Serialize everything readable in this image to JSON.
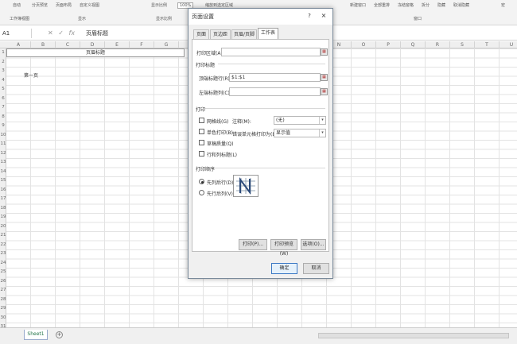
{
  "ribbon": {
    "texts": [
      "自动",
      "分页预览",
      "页面布局",
      "自定义视图",
      "显示比例",
      "100%",
      "缩放到选定区域",
      "新建窗口",
      "全部重排",
      "冻结窗格",
      "拆分",
      "隐藏",
      "取消隐藏",
      "宏",
      "工作簿视图",
      "显示",
      "显示比例",
      "窗口"
    ],
    "zoom_value": "100%"
  },
  "formula_bar": {
    "name_box": "A1",
    "formula": "页眉标题"
  },
  "grid": {
    "columns": [
      "A",
      "B",
      "C",
      "D",
      "E",
      "F",
      "G",
      "H",
      "I",
      "J",
      "K",
      "L",
      "M",
      "N",
      "O",
      "P",
      "Q",
      "R",
      "S",
      "T",
      "U",
      "V",
      "W"
    ],
    "rows": [
      "1",
      "2",
      "3",
      "4",
      "5",
      "6",
      "7",
      "8",
      "9",
      "10",
      "11",
      "12",
      "13",
      "14",
      "15",
      "16",
      "17",
      "18",
      "19",
      "20",
      "21",
      "22",
      "23",
      "24",
      "25",
      "26",
      "27",
      "28",
      "29",
      "30",
      "31"
    ],
    "title_cell": "页眉标题",
    "page_cell": "第一页"
  },
  "bottom": {
    "sheet_tab": "Sheet1",
    "add_sheet": "+"
  },
  "dialog": {
    "title": "页面设置",
    "help": "?",
    "close": "×",
    "tabs": [
      "页面",
      "页边距",
      "页眉/页脚",
      "工作表"
    ],
    "active_tab": "工作表",
    "print_area_label": "打印区域(A):",
    "print_area_value": "",
    "print_titles_label": "打印标题",
    "top_rows_label": "顶端标题行(R):",
    "top_rows_value": "$1:$1",
    "left_cols_label": "左端标题列(C):",
    "left_cols_value": "",
    "print_section_label": "打印",
    "gridlines_label": "网格线(G)",
    "bw_label": "单色打印(B)",
    "draft_label": "草稿质量(Q)",
    "rowcol_label": "行和列标题(L)",
    "comments_label": "注释(M):",
    "comments_value": "(无)",
    "errors_label": "错误单元格打印为(E):",
    "errors_value": "显示值",
    "order_section_label": "打印顺序",
    "down_then_over": "先列后行(D)",
    "over_then_down": "先行后列(V)",
    "print_button": "打印(P)...",
    "preview_button": "打印预览(W)",
    "options_button": "选项(O)...",
    "ok_button": "确定",
    "cancel_button": "取消"
  }
}
